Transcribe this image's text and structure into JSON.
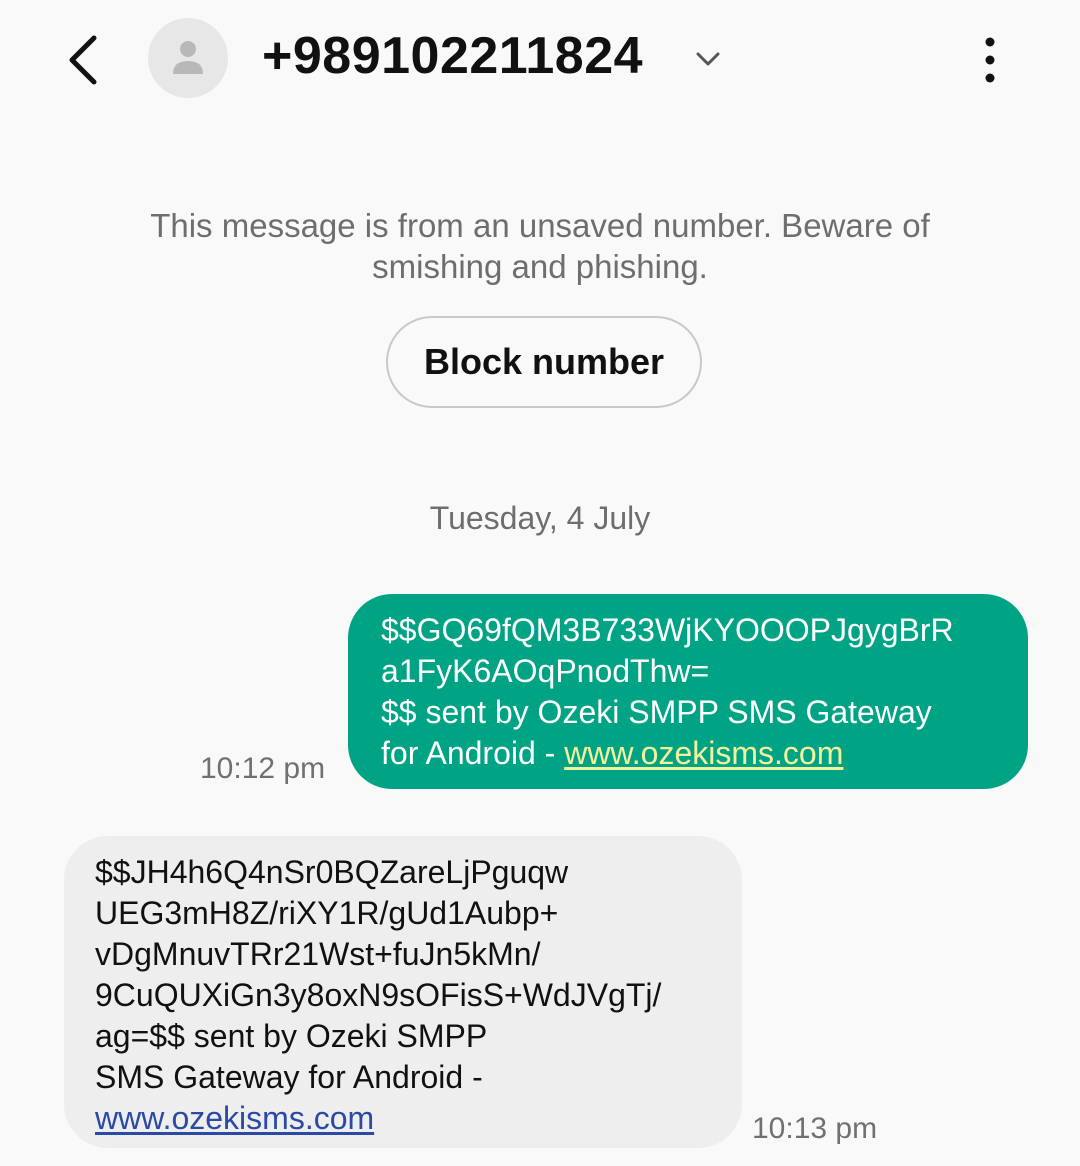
{
  "header": {
    "contact_number": "+989102211824",
    "back_icon": "back-arrow-icon",
    "avatar_icon": "person-icon",
    "expand_icon": "chevron-down-icon",
    "menu_icon": "more-vertical-icon"
  },
  "warning": {
    "text_line1": "This message is from an unsaved number. Beware of",
    "text_line2": "smishing and phishing.",
    "block_label": "Block number"
  },
  "date_separator": "Tuesday, 4 July",
  "messages": [
    {
      "direction": "outgoing",
      "lines": [
        "$$GQ69fQM3B733WjKYOOOPJgygBrR",
        "a1FyK6AOqPnodThw=",
        "$$ sent by Ozeki SMPP SMS Gateway"
      ],
      "last_line_prefix": "for Android - ",
      "link": "www.ozekisms.com",
      "time": "10:12 pm"
    },
    {
      "direction": "incoming",
      "lines": [
        "$$JH4h6Q4nSr0BQZareLjPguqw",
        "UEG3mH8Z/riXY1R/gUd1Aubp+",
        "vDgMnuvTRr21Wst+fuJn5kMn/",
        "9CuQUXiGn3y8oxN9sOFisS+WdJVgTj/",
        "ag=$$ sent by Ozeki SMPP",
        "SMS Gateway for Android -"
      ],
      "link": "www.ozekisms.com",
      "time": "10:13 pm"
    }
  ],
  "colors": {
    "background": "#f9f9f9",
    "outgoing_bubble": "#00a485",
    "outgoing_link": "#f4f19c",
    "incoming_bubble": "#eeeeee",
    "incoming_link": "#2b4aa6",
    "secondary_text": "#6e6e6e"
  }
}
